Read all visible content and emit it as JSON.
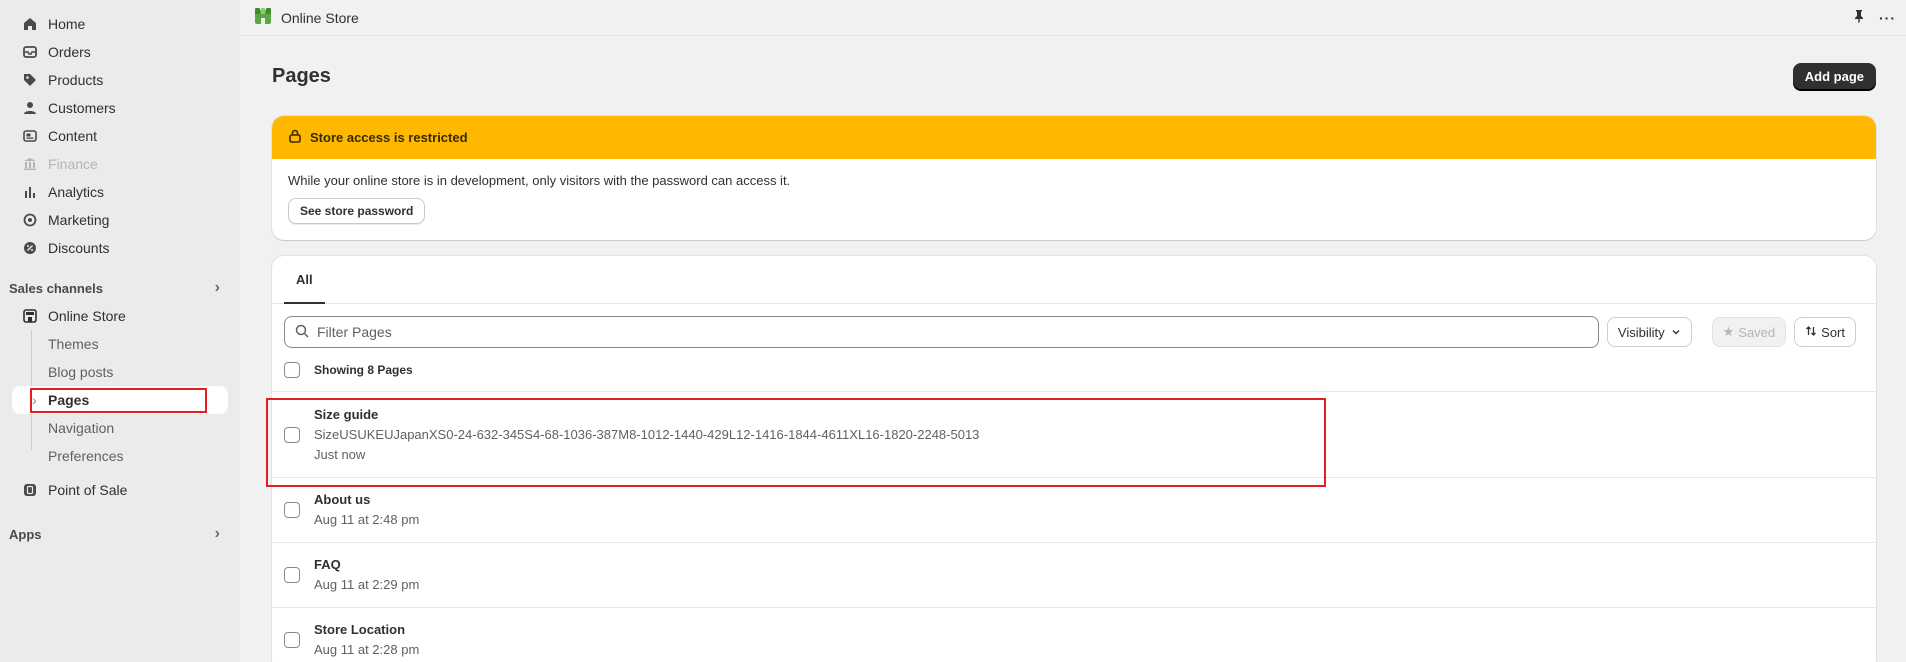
{
  "topbar": {
    "title": "Online Store"
  },
  "sidebar": {
    "items": [
      {
        "label": "Home",
        "icon": "home-icon"
      },
      {
        "label": "Orders",
        "icon": "orders-icon"
      },
      {
        "label": "Products",
        "icon": "tag-icon"
      },
      {
        "label": "Customers",
        "icon": "person-icon"
      },
      {
        "label": "Content",
        "icon": "content-icon"
      },
      {
        "label": "Finance",
        "icon": "bank-icon",
        "disabled": true
      },
      {
        "label": "Analytics",
        "icon": "bar-chart-icon"
      },
      {
        "label": "Marketing",
        "icon": "target-icon"
      },
      {
        "label": "Discounts",
        "icon": "discount-icon"
      }
    ],
    "sales_channels_label": "Sales channels",
    "online_store_label": "Online Store",
    "sub_items": [
      "Themes",
      "Blog posts",
      "Pages",
      "Navigation",
      "Preferences"
    ],
    "point_of_sale_label": "Point of Sale",
    "apps_label": "Apps"
  },
  "page": {
    "title": "Pages",
    "add_button": "Add page"
  },
  "banner": {
    "title": "Store access is restricted",
    "body": "While your online store is in development, only visitors with the password can access it.",
    "button": "See store password",
    "color": "#ffb800"
  },
  "list": {
    "tab_all": "All",
    "search_placeholder": "Filter Pages",
    "visibility_label": "Visibility",
    "saved_label": "Saved",
    "sort_label": "Sort",
    "showing": "Showing 8 Pages",
    "rows": [
      {
        "name": "Size guide",
        "content": "SizeUSUKEUJapanXS0-24-632-345S4-68-1036-387M8-1012-1440-429L12-1416-1844-4611XL16-1820-2248-5013",
        "time": "Just now"
      },
      {
        "name": "About us",
        "time": "Aug 11 at 2:48 pm"
      },
      {
        "name": "FAQ",
        "time": "Aug 11 at 2:29 pm"
      },
      {
        "name": "Store Location",
        "time": "Aug 11 at 2:28 pm"
      }
    ]
  }
}
